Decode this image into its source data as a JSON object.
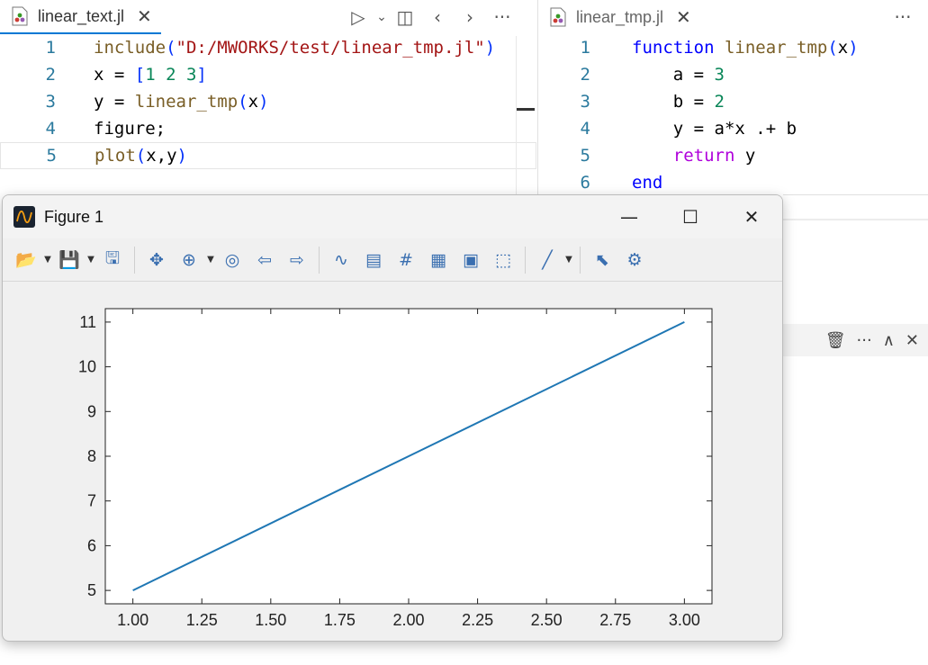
{
  "left_editor": {
    "tab_label": "linear_text.jl",
    "close_glyph": "✕",
    "actions": [
      "▷",
      "⌄",
      "◫",
      "‹",
      "›",
      "···"
    ],
    "lines": [
      {
        "n": "1",
        "parts": [
          [
            "fn",
            "include"
          ],
          [
            "br",
            "("
          ],
          [
            "str",
            "\"D:/MWORKS/test/linear_tmp.jl\""
          ],
          [
            "br",
            ")"
          ]
        ]
      },
      {
        "n": "2",
        "parts": [
          [
            "plain",
            "x = "
          ],
          [
            "br",
            "["
          ],
          [
            "num",
            "1 2 3"
          ],
          [
            "br",
            "]"
          ]
        ]
      },
      {
        "n": "3",
        "parts": [
          [
            "plain",
            "y = "
          ],
          [
            "fn",
            "linear_tmp"
          ],
          [
            "br",
            "("
          ],
          [
            "plain",
            "x"
          ],
          [
            "br",
            ")"
          ]
        ]
      },
      {
        "n": "4",
        "parts": [
          [
            "plain",
            "figure;"
          ]
        ]
      },
      {
        "n": "5",
        "parts": [
          [
            "fn",
            "plot"
          ],
          [
            "br",
            "("
          ],
          [
            "plain",
            "x,y"
          ],
          [
            "br",
            ")"
          ]
        ]
      }
    ]
  },
  "right_editor": {
    "tab_label": "linear_tmp.jl",
    "close_glyph": "✕",
    "more_glyph": "···",
    "lines": [
      {
        "n": "1",
        "parts": [
          [
            "kw",
            "function "
          ],
          [
            "fn",
            "linear_tmp"
          ],
          [
            "br",
            "("
          ],
          [
            "plain",
            "x"
          ],
          [
            "br",
            ")"
          ]
        ]
      },
      {
        "n": "2",
        "parts": [
          [
            "plain",
            "    a = "
          ],
          [
            "num",
            "3"
          ]
        ]
      },
      {
        "n": "3",
        "parts": [
          [
            "plain",
            "    b = "
          ],
          [
            "num",
            "2"
          ]
        ]
      },
      {
        "n": "4",
        "parts": [
          [
            "plain",
            "    y = a*x .+ b"
          ]
        ]
      },
      {
        "n": "5",
        "parts": [
          [
            "ret",
            "    return "
          ],
          [
            "plain",
            "y"
          ]
        ]
      },
      {
        "n": "6",
        "parts": [
          [
            "kw",
            "end"
          ]
        ]
      }
    ]
  },
  "panel_actions": [
    "🗑",
    "···",
    "∧",
    "✕"
  ],
  "figure": {
    "title": "Figure 1",
    "window_buttons": {
      "minimize": "—",
      "maximize": "☐",
      "close": "✕"
    },
    "toolbar": [
      {
        "name": "open-icon",
        "glyph": "📂",
        "drop": true
      },
      {
        "name": "save-icon",
        "glyph": "💾",
        "drop": true
      },
      {
        "name": "export-icon",
        "glyph": "🖫",
        "drop": false
      },
      {
        "sep": true
      },
      {
        "name": "pan-icon",
        "glyph": "✥",
        "drop": false
      },
      {
        "name": "zoom-in-icon",
        "glyph": "⊕",
        "drop": true
      },
      {
        "name": "zoom-fit-icon",
        "glyph": "◎",
        "drop": false
      },
      {
        "name": "back-icon",
        "glyph": "⇦",
        "drop": false
      },
      {
        "name": "forward-icon",
        "glyph": "⇨",
        "drop": false
      },
      {
        "sep": true
      },
      {
        "name": "data-cursor-icon",
        "glyph": "∿",
        "drop": false
      },
      {
        "name": "legend-icon",
        "glyph": "▤",
        "drop": false
      },
      {
        "name": "grid-icon",
        "glyph": "#",
        "drop": false
      },
      {
        "name": "properties-icon",
        "glyph": "▦",
        "drop": false
      },
      {
        "name": "colorbar-icon",
        "glyph": "▣",
        "drop": false
      },
      {
        "name": "box-icon",
        "glyph": "⬚",
        "drop": false
      },
      {
        "sep": true
      },
      {
        "name": "line-style-icon",
        "glyph": "╱",
        "drop": true
      },
      {
        "sep": true
      },
      {
        "name": "pointer-icon",
        "glyph": "⬉",
        "drop": false
      },
      {
        "name": "settings-icon",
        "glyph": "⚙",
        "drop": false
      }
    ]
  },
  "chart_data": {
    "type": "line",
    "x": [
      1,
      2,
      3
    ],
    "series": [
      {
        "values": [
          5,
          8,
          11
        ],
        "color": "#1f77b4"
      }
    ],
    "xlim": [
      0.9,
      3.1
    ],
    "ylim": [
      4.7,
      11.3
    ],
    "xticks": [
      "1.00",
      "1.25",
      "1.50",
      "1.75",
      "2.00",
      "2.25",
      "2.50",
      "2.75",
      "3.00"
    ],
    "yticks": [
      "5",
      "6",
      "7",
      "8",
      "9",
      "10",
      "11"
    ],
    "title": "",
    "xlabel": "",
    "ylabel": "",
    "grid": false
  },
  "colors": {
    "accent": "#0078d4",
    "line": "#1f77b4"
  }
}
